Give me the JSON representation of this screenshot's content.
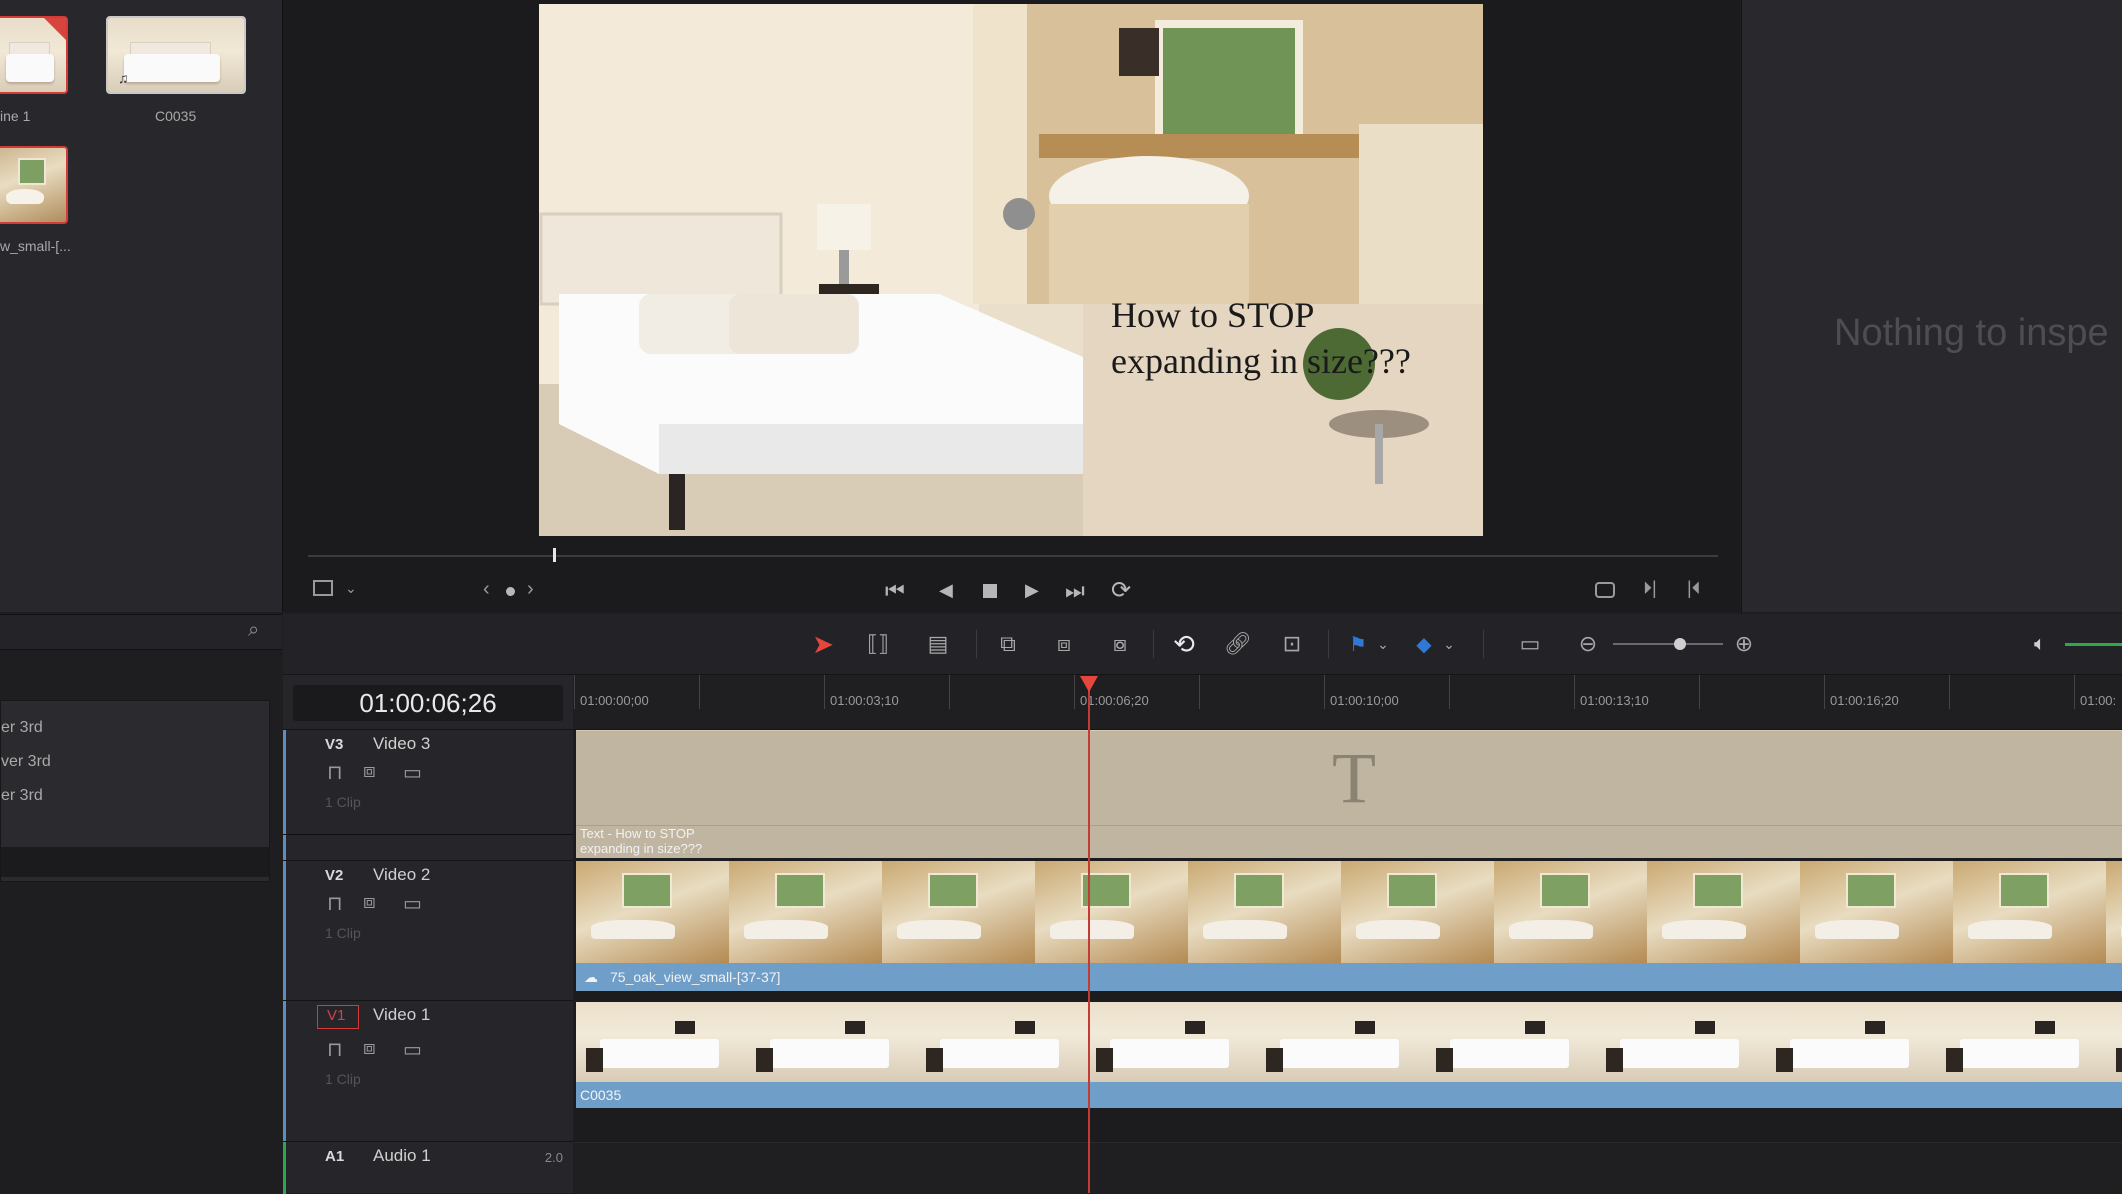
{
  "media_pool": {
    "clips": [
      {
        "label": "ine 1",
        "selected": false
      },
      {
        "label": "C0035",
        "selected": false
      },
      {
        "label": "w_small-[...",
        "selected": true
      }
    ]
  },
  "viewer": {
    "overlay_text_line1": "How to STOP",
    "overlay_text_line2": "expanding in size???",
    "controls": {
      "skip_back_icon": "skip-to-start-icon",
      "play_icon": "play-icon",
      "loop_icon": "loop-icon"
    }
  },
  "inspector": {
    "empty_message": "Nothing to inspe"
  },
  "effects": {
    "items": [
      "er 3rd",
      "ver 3rd",
      "er 3rd"
    ]
  },
  "timeline": {
    "timecode": "01:00:06;26",
    "ruler_labels": [
      "01:00:00;00",
      "01:00:03;10",
      "01:00:06;20",
      "01:00:10;00",
      "01:00:13;10",
      "01:00:16;20",
      "01:00:"
    ],
    "tracks": [
      {
        "id": "V3",
        "name": "Video 3",
        "clip_count": "1 Clip"
      },
      {
        "id": "V2",
        "name": "Video 2",
        "clip_count": "1 Clip"
      },
      {
        "id": "V1",
        "name": "Video 1",
        "clip_count": "1 Clip"
      },
      {
        "id": "A1",
        "name": "Audio 1",
        "channels": "2.0"
      }
    ],
    "clips": {
      "text_clip_line1": "Text - How to STOP",
      "text_clip_line2": "expanding in size???",
      "text_clip_glyph": "T",
      "v2_clip_label": "75_oak_view_small-[37-37]",
      "v1_clip_label": "C0035"
    }
  },
  "colors": {
    "accent_red": "#e6463e",
    "clip_blue": "#6f9ec9",
    "text_clip_bg": "#bfb5a0",
    "flag_blue": "#2f78d6",
    "audio_green": "#2ea84a"
  }
}
